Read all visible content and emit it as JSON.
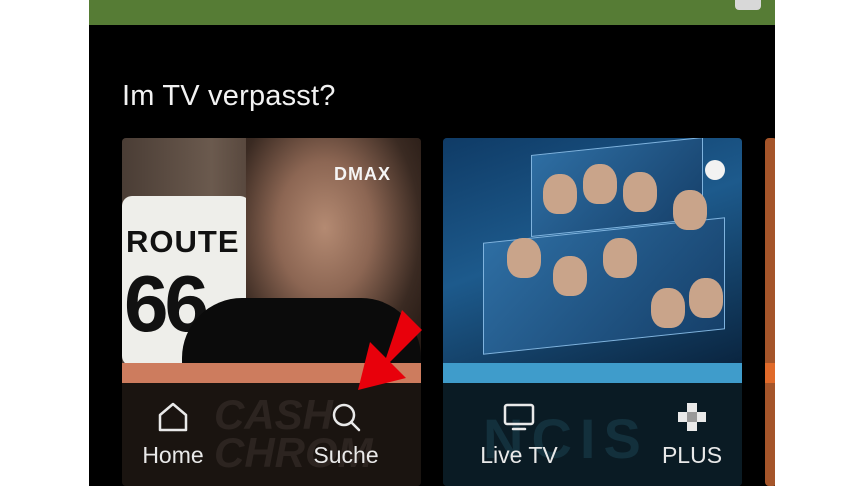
{
  "section": {
    "title": "Im TV verpasst?"
  },
  "cards": [
    {
      "channel_logo": "DMAX",
      "sign_line1": "ROUTE",
      "sign_line2": "66",
      "watermark": "CASH\nCHROM",
      "accent_color": "#cd7c5e"
    },
    {
      "channel_logo": "sat1-icon",
      "watermark": "NCIS",
      "accent_color": "#3f9ccb"
    },
    {
      "accent_color": "#e06a2a"
    }
  ],
  "nav": {
    "home": {
      "label": "Home",
      "icon": "home-icon"
    },
    "search": {
      "label": "Suche",
      "icon": "search-icon"
    },
    "livetv": {
      "label": "Live TV",
      "icon": "tv-icon"
    },
    "plus": {
      "label": "PLUS",
      "icon": "plus-icon"
    }
  },
  "colors": {
    "banner": "#567c35",
    "background": "#000000",
    "annotation_arrow": "#e8000b"
  }
}
